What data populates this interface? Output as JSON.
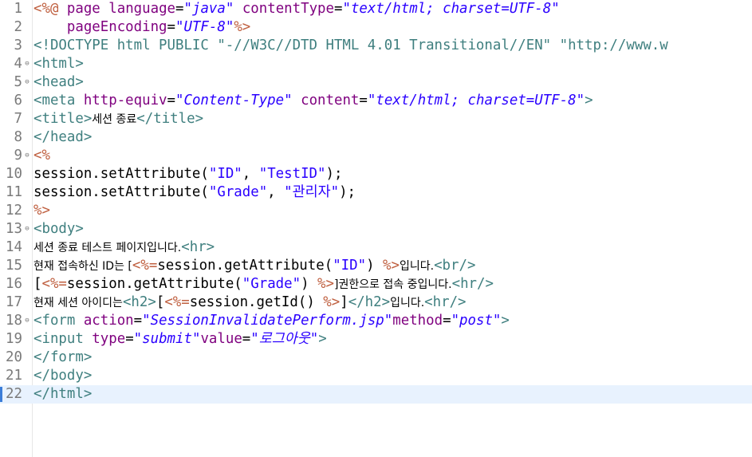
{
  "editor": {
    "fold_icon": "fold-toggle-icon",
    "current_line": 22,
    "colors": {
      "tag": "#3f7f7f",
      "attribute": "#7f007f",
      "value": "#2a00ff",
      "jsp_delimiter": "#bf5f3f",
      "current_line_bg": "#e8f2fe",
      "line_number": "#7a7a7a"
    },
    "lines": [
      {
        "n": "1",
        "fold": "",
        "tokens": [
          {
            "c": "jsp",
            "t": "<%@ "
          },
          {
            "c": "attr",
            "t": "page "
          },
          {
            "c": "attr",
            "t": "language"
          },
          {
            "c": "plain",
            "t": "="
          },
          {
            "c": "val",
            "t": "\"java\""
          },
          {
            "c": "plain",
            "t": " "
          },
          {
            "c": "attr",
            "t": "contentType"
          },
          {
            "c": "plain",
            "t": "="
          },
          {
            "c": "val",
            "t": "\"text/html; charset=UTF-8\""
          }
        ]
      },
      {
        "n": "2",
        "fold": "",
        "tokens": [
          {
            "c": "plain",
            "t": "    "
          },
          {
            "c": "attr",
            "t": "pageEncoding"
          },
          {
            "c": "plain",
            "t": "="
          },
          {
            "c": "val",
            "t": "\"UTF-8\""
          },
          {
            "c": "jsp",
            "t": "%>"
          }
        ]
      },
      {
        "n": "3",
        "fold": "",
        "tokens": [
          {
            "c": "doc",
            "t": "<!DOCTYPE html PUBLIC \"-//W3C//DTD HTML 4.01 Transitional//EN\" \"http://www.w"
          }
        ]
      },
      {
        "n": "4",
        "fold": "⊖",
        "tokens": [
          {
            "c": "tag",
            "t": "<html>"
          }
        ]
      },
      {
        "n": "5",
        "fold": "⊖",
        "tokens": [
          {
            "c": "tag",
            "t": "<head>"
          }
        ]
      },
      {
        "n": "6",
        "fold": "",
        "tokens": [
          {
            "c": "tag",
            "t": "<meta "
          },
          {
            "c": "attr",
            "t": "http-equiv"
          },
          {
            "c": "plain",
            "t": "="
          },
          {
            "c": "val",
            "t": "\"Content-Type\""
          },
          {
            "c": "plain",
            "t": " "
          },
          {
            "c": "attr",
            "t": "content"
          },
          {
            "c": "plain",
            "t": "="
          },
          {
            "c": "val",
            "t": "\"text/html; charset=UTF-8\""
          },
          {
            "c": "tag",
            "t": ">"
          }
        ]
      },
      {
        "n": "7",
        "fold": "",
        "tokens": [
          {
            "c": "tag",
            "t": "<title>"
          },
          {
            "c": "kor",
            "t": "세션 종료"
          },
          {
            "c": "tag",
            "t": "</title>"
          }
        ]
      },
      {
        "n": "8",
        "fold": "",
        "tokens": [
          {
            "c": "tag",
            "t": "</head>"
          }
        ]
      },
      {
        "n": "9",
        "fold": "⊖",
        "tokens": [
          {
            "c": "jsp",
            "t": "<%"
          }
        ]
      },
      {
        "n": "10",
        "fold": "",
        "tokens": [
          {
            "c": "plain",
            "t": "session.setAttribute("
          },
          {
            "c": "str",
            "t": "\"ID\""
          },
          {
            "c": "plain",
            "t": ", "
          },
          {
            "c": "str",
            "t": "\"TestID\""
          },
          {
            "c": "plain",
            "t": ");"
          }
        ]
      },
      {
        "n": "11",
        "fold": "",
        "tokens": [
          {
            "c": "plain",
            "t": "session.setAttribute("
          },
          {
            "c": "str",
            "t": "\"Grade\""
          },
          {
            "c": "plain",
            "t": ", "
          },
          {
            "c": "str",
            "t": "\"관리자\""
          },
          {
            "c": "plain",
            "t": ");"
          }
        ]
      },
      {
        "n": "12",
        "fold": "",
        "tokens": [
          {
            "c": "jsp",
            "t": "%>"
          }
        ]
      },
      {
        "n": "13",
        "fold": "⊖",
        "tokens": [
          {
            "c": "tag",
            "t": "<body>"
          }
        ]
      },
      {
        "n": "14",
        "fold": "",
        "tokens": [
          {
            "c": "kor",
            "t": "세션 종료 테스트 페이지입니다."
          },
          {
            "c": "tag",
            "t": "<hr>"
          }
        ]
      },
      {
        "n": "15",
        "fold": "",
        "tokens": [
          {
            "c": "kor",
            "t": "현재 접속하신 ID는 ["
          },
          {
            "c": "jsp",
            "t": "<%="
          },
          {
            "c": "plain",
            "t": "session.getAttribute("
          },
          {
            "c": "str",
            "t": "\"ID\""
          },
          {
            "c": "plain",
            "t": ") "
          },
          {
            "c": "jsp",
            "t": "%>"
          },
          {
            "c": "kor",
            "t": "입니다."
          },
          {
            "c": "tag",
            "t": "<br/>"
          }
        ]
      },
      {
        "n": "16",
        "fold": "",
        "tokens": [
          {
            "c": "plain",
            "t": "["
          },
          {
            "c": "jsp",
            "t": "<%="
          },
          {
            "c": "plain",
            "t": "session.getAttribute("
          },
          {
            "c": "str",
            "t": "\"Grade\""
          },
          {
            "c": "plain",
            "t": ") "
          },
          {
            "c": "jsp",
            "t": "%>"
          },
          {
            "c": "kor",
            "t": "]권한으로 접속 중입니다."
          },
          {
            "c": "tag",
            "t": "<hr/>"
          }
        ]
      },
      {
        "n": "17",
        "fold": "",
        "tokens": [
          {
            "c": "kor",
            "t": "현재 세션 아이디는"
          },
          {
            "c": "tag",
            "t": "<h2>"
          },
          {
            "c": "plain",
            "t": "["
          },
          {
            "c": "jsp",
            "t": "<%="
          },
          {
            "c": "plain",
            "t": "session.getId() "
          },
          {
            "c": "jsp",
            "t": "%>"
          },
          {
            "c": "plain",
            "t": "]"
          },
          {
            "c": "tag",
            "t": "</h2>"
          },
          {
            "c": "kor",
            "t": "입니다."
          },
          {
            "c": "tag",
            "t": "<hr/>"
          }
        ]
      },
      {
        "n": "18",
        "fold": "⊖",
        "tokens": [
          {
            "c": "tag",
            "t": "<form "
          },
          {
            "c": "attr",
            "t": "action"
          },
          {
            "c": "plain",
            "t": "="
          },
          {
            "c": "val",
            "t": "\"SessionInvalidatePerform.jsp\""
          },
          {
            "c": "attr",
            "t": "method"
          },
          {
            "c": "plain",
            "t": "="
          },
          {
            "c": "val",
            "t": "\"post\""
          },
          {
            "c": "tag",
            "t": ">"
          }
        ]
      },
      {
        "n": "19",
        "fold": "",
        "tokens": [
          {
            "c": "tag",
            "t": "<input "
          },
          {
            "c": "attr",
            "t": "type"
          },
          {
            "c": "plain",
            "t": "="
          },
          {
            "c": "val",
            "t": "\"submit\""
          },
          {
            "c": "attr",
            "t": "value"
          },
          {
            "c": "plain",
            "t": "="
          },
          {
            "c": "val",
            "t": "\"로그아웃\""
          },
          {
            "c": "tag",
            "t": ">"
          }
        ]
      },
      {
        "n": "20",
        "fold": "",
        "tokens": [
          {
            "c": "tag",
            "t": "</form>"
          }
        ]
      },
      {
        "n": "21",
        "fold": "",
        "tokens": [
          {
            "c": "tag",
            "t": "</body>"
          }
        ]
      },
      {
        "n": "22",
        "fold": "",
        "tokens": [
          {
            "c": "tag",
            "t": "</html>"
          }
        ]
      }
    ]
  }
}
